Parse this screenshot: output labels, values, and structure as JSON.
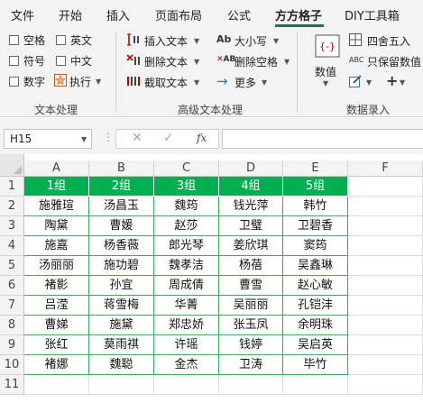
{
  "ribbon_tabs": [
    "文件",
    "开始",
    "插入",
    "页面布局",
    "公式",
    "方方格子",
    "DIY工具箱"
  ],
  "active_tab": "方方格子",
  "text_processing": {
    "checkboxes": [
      "空格",
      "英文",
      "符号",
      "中文",
      "数字"
    ],
    "execute_label": "执行",
    "group_label": "文本处理"
  },
  "advanced_text": {
    "insert_text": "插入文本",
    "delete_text": "删除文本",
    "extract_text": "截取文本",
    "case_label": "大小写",
    "delete_spaces": "删除空格",
    "more_label": "更多",
    "case_icon_text": "Ab",
    "spaces_icon_text": "AB",
    "group_label": "高级文本处理"
  },
  "number_entry": {
    "value_label": "数值",
    "round_label": "四舍五入",
    "keep_value_label": "只保留数值",
    "keep_value_icon_text": "ABC",
    "group_label": "数据录入"
  },
  "formula_bar": {
    "name_box": "H15",
    "fx_label": "fx",
    "formula_value": ""
  },
  "sheet": {
    "column_headers": [
      "A",
      "B",
      "C",
      "D",
      "E",
      "F"
    ],
    "row_numbers": [
      "1",
      "2",
      "3",
      "4",
      "5",
      "6",
      "7",
      "8",
      "9",
      "10",
      "11"
    ],
    "header_row": [
      "1组",
      "2组",
      "3组",
      "4组",
      "5组"
    ],
    "rows": [
      [
        "施雅瑄",
        "汤昌玉",
        "魏筠",
        "钱光萍",
        "韩竹"
      ],
      [
        "陶黛",
        "曹媛",
        "赵莎",
        "卫璧",
        "卫碧香"
      ],
      [
        "施嘉",
        "杨香薇",
        "郎光琴",
        "姜欣琪",
        "窦筠"
      ],
      [
        "汤丽丽",
        "施功碧",
        "魏孝洁",
        "杨蓓",
        "吴鑫琳"
      ],
      [
        "褚影",
        "孙宜",
        "周成倩",
        "曹雪",
        "赵心敏"
      ],
      [
        "吕滢",
        "蒋雪梅",
        "华菁",
        "吴丽丽",
        "孔铠沣"
      ],
      [
        "曹娣",
        "施黛",
        "郑忠娇",
        "张玉凤",
        "余明珠"
      ],
      [
        "张红",
        "莫雨祺",
        "许瑶",
        "钱婷",
        "吴启英"
      ],
      [
        "褚娜",
        "魏聪",
        "金杰",
        "卫涛",
        "毕竹"
      ]
    ],
    "header_fill": "#00b050",
    "border_color": "#3aaa5c"
  },
  "colors": {
    "accent": "#217346"
  }
}
